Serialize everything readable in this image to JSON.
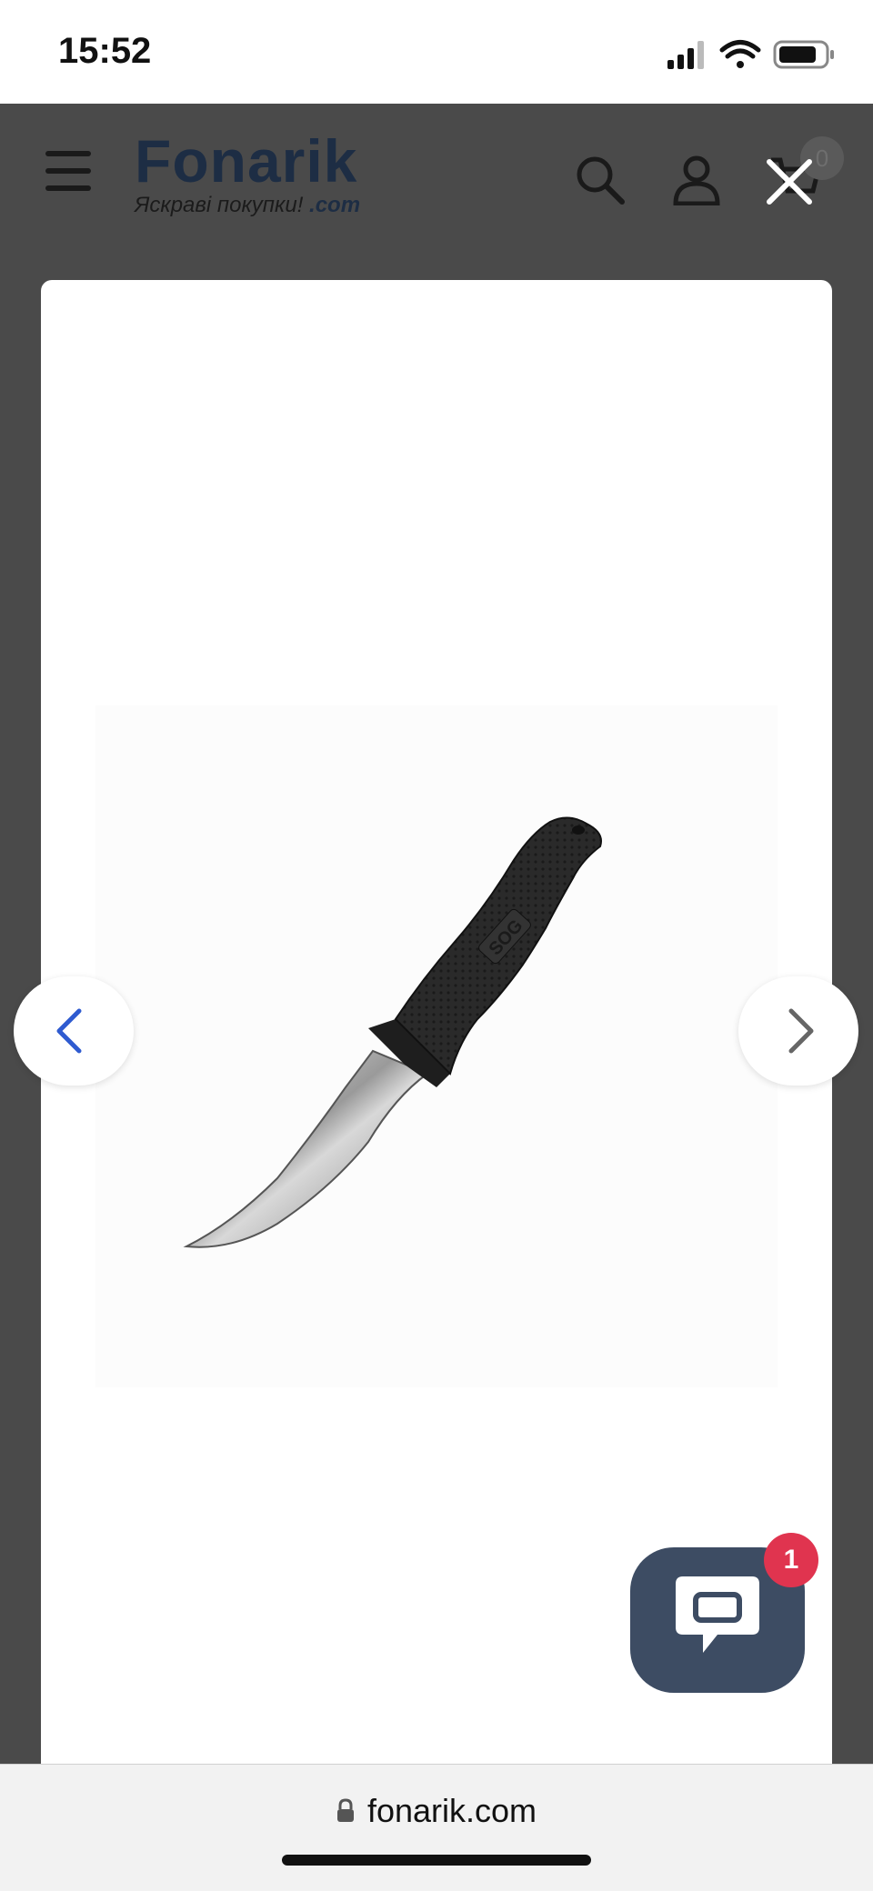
{
  "status_bar": {
    "time": "15:52",
    "icons": [
      "cellular-signal-icon",
      "wifi-icon",
      "battery-icon"
    ]
  },
  "header": {
    "logo_main": "Fonarik",
    "logo_tagline": "Яскраві покупки!",
    "logo_domain": ".com",
    "cart_count": "0",
    "icons": [
      "menu-icon",
      "search-icon",
      "user-icon",
      "cart-icon",
      "close-icon"
    ]
  },
  "lightbox": {
    "image_alt": "SOG",
    "prev_icon": "chevron-left-icon",
    "next_icon": "chevron-right-icon"
  },
  "chat": {
    "badge_count": "1",
    "icon": "chat-bubble-icon"
  },
  "browser": {
    "url": "fonarik.com",
    "icon": "lock-icon"
  },
  "colors": {
    "overlay": "#4a4a4a",
    "chat_widget": "#3d4c63",
    "chat_badge": "#e0344f",
    "nav_chevron_left": "#2f5bd0",
    "brand": "#1d2d44"
  }
}
